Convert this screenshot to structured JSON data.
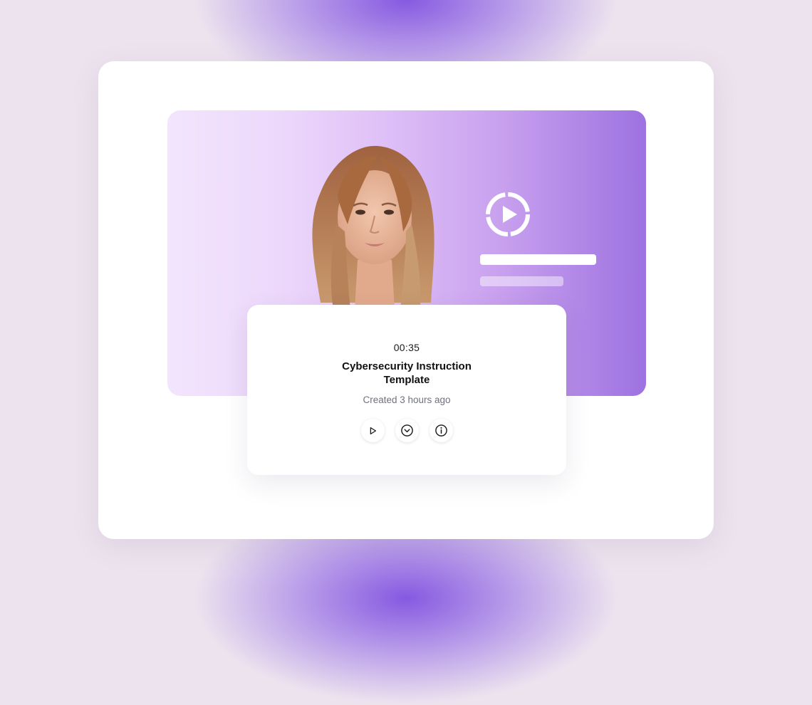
{
  "video_card": {
    "duration": "00:35",
    "title_line_1": "Cybersecurity Instruction",
    "title_line_2": "Template",
    "created": "Created 3 hours ago"
  },
  "actions": [
    {
      "icon": "play-icon"
    },
    {
      "icon": "chevron-down-circle-icon"
    },
    {
      "icon": "info-icon"
    }
  ],
  "colors": {
    "accent": "#9d72e1",
    "hero_gradient_start": "#f3e5fd",
    "hero_gradient_end": "#9d72e1",
    "background": "#ede3ee"
  }
}
